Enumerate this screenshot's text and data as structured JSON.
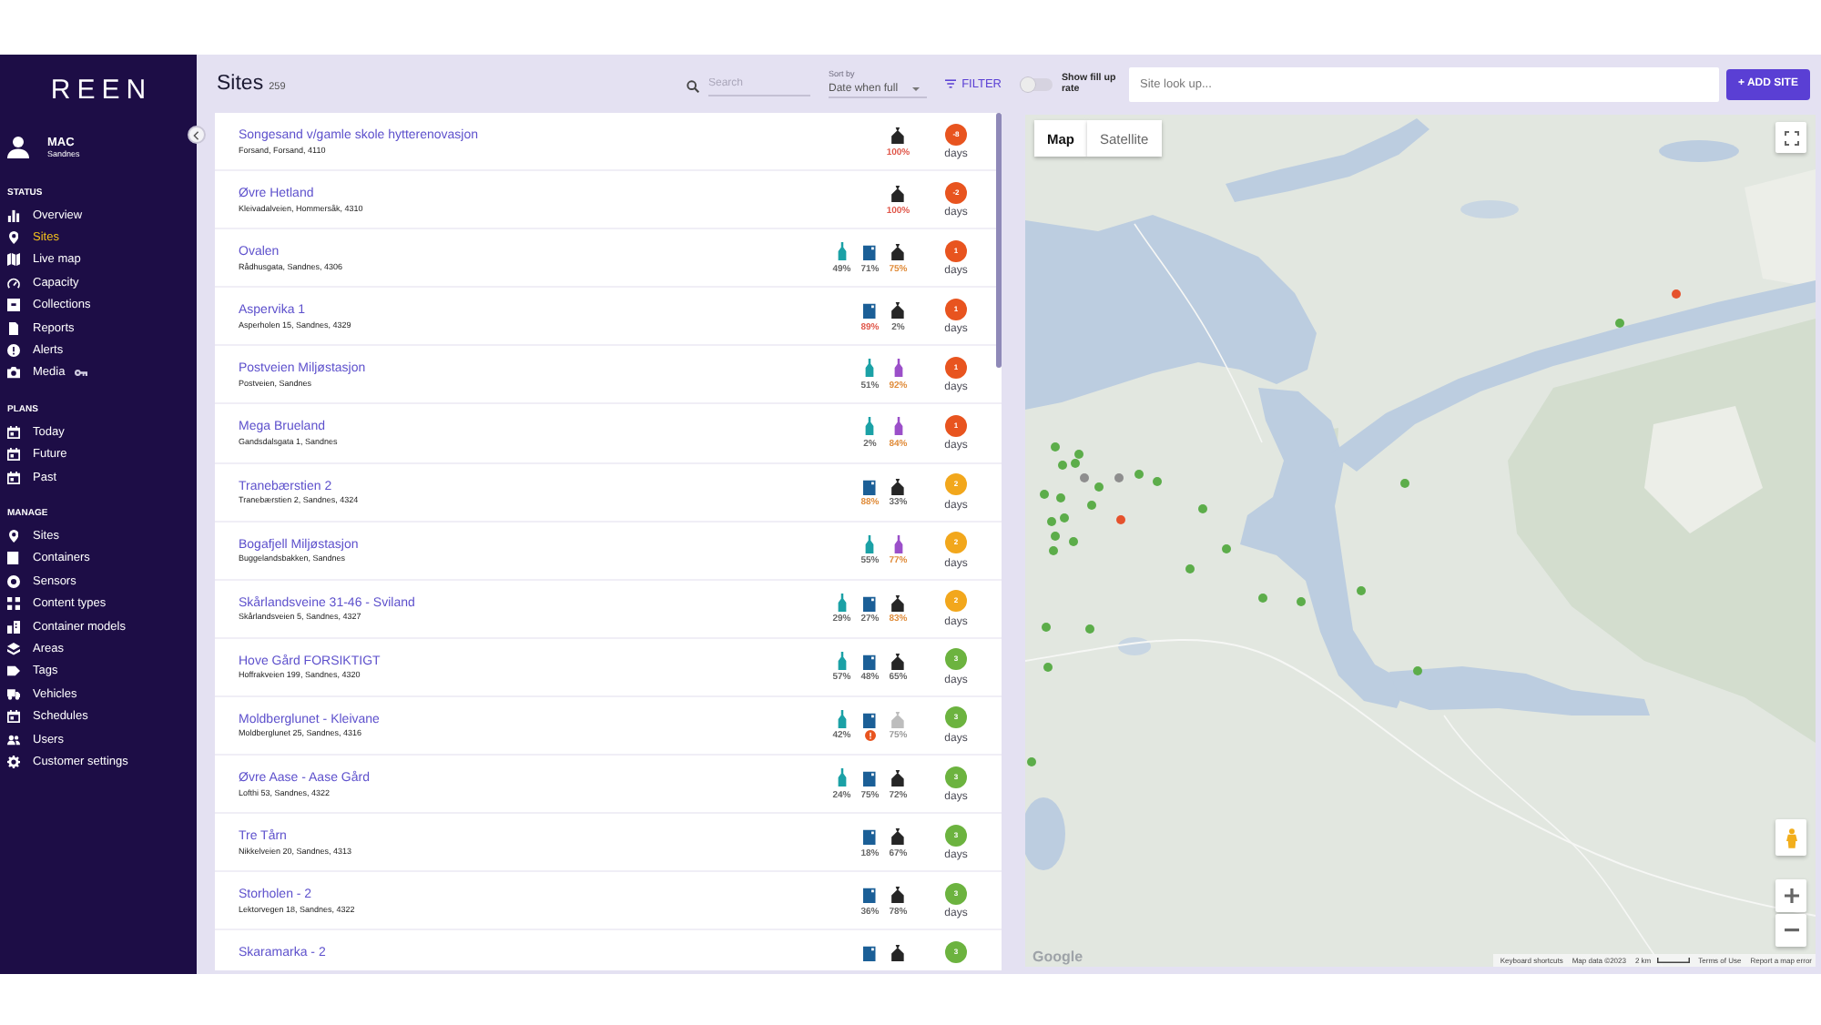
{
  "sidebar": {
    "logo": "REEN",
    "user": {
      "name": "MAC",
      "location": "Sandnes"
    },
    "sections": [
      {
        "title": "STATUS",
        "items": [
          {
            "label": "Overview",
            "selected": false
          },
          {
            "label": "Sites",
            "selected": true
          },
          {
            "label": "Live map",
            "selected": false
          },
          {
            "label": "Capacity",
            "selected": false
          },
          {
            "label": "Collections",
            "selected": false
          },
          {
            "label": "Reports",
            "selected": false
          },
          {
            "label": "Alerts",
            "selected": false
          },
          {
            "label": "Media",
            "selected": false
          }
        ]
      },
      {
        "title": "PLANS",
        "items": [
          {
            "label": "Today",
            "selected": false
          },
          {
            "label": "Future",
            "selected": false
          },
          {
            "label": "Past",
            "selected": false
          }
        ]
      },
      {
        "title": "MANAGE",
        "items": [
          {
            "label": "Sites",
            "selected": false
          },
          {
            "label": "Containers",
            "selected": false
          },
          {
            "label": "Sensors",
            "selected": false
          },
          {
            "label": "Content types",
            "selected": false
          },
          {
            "label": "Container models",
            "selected": false
          },
          {
            "label": "Areas",
            "selected": false
          },
          {
            "label": "Tags",
            "selected": false
          },
          {
            "label": "Vehicles",
            "selected": false
          },
          {
            "label": "Schedules",
            "selected": false
          },
          {
            "label": "Users",
            "selected": false
          },
          {
            "label": "Customer settings",
            "selected": false
          }
        ]
      }
    ]
  },
  "toolbar": {
    "title": "Sites",
    "count": "259",
    "search": {
      "placeholder": "Search"
    },
    "sort": {
      "label": "Sort by",
      "value": "Date when full"
    },
    "filter": "FILTER",
    "fill_up_rate": {
      "label": "Show fill up rate",
      "on": false
    },
    "lookup": {
      "placeholder": "Site look up..."
    },
    "add_button": "+ ADD SITE"
  },
  "sites": [
    {
      "name": "Songesand v/gamle skole hytterenovasjon",
      "address": "Forsand, Forsand, 4110",
      "containers": [
        {
          "kind": "bag",
          "color": "#262626",
          "reading": {
            "text": "100%",
            "color": "#e0574a"
          },
          "alert": false,
          "disabled": false
        }
      ],
      "days": {
        "value": "-8",
        "color": "#e8541f",
        "label": "days"
      }
    },
    {
      "name": "Øvre Hetland",
      "address": "Kleivadalveien, Hommersåk, 4310",
      "containers": [
        {
          "kind": "bag",
          "color": "#262626",
          "reading": {
            "text": "100%",
            "color": "#e0574a"
          },
          "alert": false,
          "disabled": false
        }
      ],
      "days": {
        "value": "-2",
        "color": "#e8541f",
        "label": "days"
      }
    },
    {
      "name": "Ovalen",
      "address": "Rådhusgata, Sandnes, 4306",
      "containers": [
        {
          "kind": "bottle",
          "color": "#1ba1a6",
          "reading": {
            "text": "49%",
            "color": "#666666"
          },
          "alert": false,
          "disabled": false
        },
        {
          "kind": "bin",
          "color": "#1b5f97",
          "reading": {
            "text": "71%",
            "color": "#666666"
          },
          "alert": false,
          "disabled": false
        },
        {
          "kind": "bag",
          "color": "#262626",
          "reading": {
            "text": "75%",
            "color": "#e08c3a"
          },
          "alert": false,
          "disabled": false
        }
      ],
      "days": {
        "value": "1",
        "color": "#e8541f",
        "label": "days"
      }
    },
    {
      "name": "Aspervika 1",
      "address": "Asperholen 15, Sandnes, 4329",
      "containers": [
        {
          "kind": "bin",
          "color": "#1b5f97",
          "reading": {
            "text": "89%",
            "color": "#e0574a"
          },
          "alert": false,
          "disabled": false
        },
        {
          "kind": "bag",
          "color": "#262626",
          "reading": {
            "text": "2%",
            "color": "#666666"
          },
          "alert": false,
          "disabled": false
        }
      ],
      "days": {
        "value": "1",
        "color": "#e8541f",
        "label": "days"
      }
    },
    {
      "name": "Postveien Miljøstasjon",
      "address": "Postveien, Sandnes",
      "containers": [
        {
          "kind": "bottle",
          "color": "#1ba1a6",
          "reading": {
            "text": "51%",
            "color": "#666666"
          },
          "alert": false,
          "disabled": false
        },
        {
          "kind": "bottle",
          "color": "#9b4fc9",
          "reading": {
            "text": "92%",
            "color": "#e08c3a"
          },
          "alert": false,
          "disabled": false
        }
      ],
      "days": {
        "value": "1",
        "color": "#e8541f",
        "label": "days"
      }
    },
    {
      "name": "Mega Brueland",
      "address": "Gandsdalsgata 1, Sandnes",
      "containers": [
        {
          "kind": "bottle",
          "color": "#1ba1a6",
          "reading": {
            "text": "2%",
            "color": "#666666"
          },
          "alert": false,
          "disabled": false
        },
        {
          "kind": "bottle",
          "color": "#9b4fc9",
          "reading": {
            "text": "84%",
            "color": "#e08c3a"
          },
          "alert": false,
          "disabled": false
        }
      ],
      "days": {
        "value": "1",
        "color": "#e8541f",
        "label": "days"
      }
    },
    {
      "name": "Tranebærstien 2",
      "address": "Tranebærstien 2, Sandnes, 4324",
      "containers": [
        {
          "kind": "bin",
          "color": "#1b5f97",
          "reading": {
            "text": "88%",
            "color": "#e08c3a"
          },
          "alert": false,
          "disabled": false
        },
        {
          "kind": "bag",
          "color": "#262626",
          "reading": {
            "text": "33%",
            "color": "#666666"
          },
          "alert": false,
          "disabled": false
        }
      ],
      "days": {
        "value": "2",
        "color": "#f2a71c",
        "label": "days"
      }
    },
    {
      "name": "Bogafjell Miljøstasjon",
      "address": "Buggelandsbakken, Sandnes",
      "containers": [
        {
          "kind": "bottle",
          "color": "#1ba1a6",
          "reading": {
            "text": "55%",
            "color": "#666666"
          },
          "alert": false,
          "disabled": false
        },
        {
          "kind": "bottle",
          "color": "#9b4fc9",
          "reading": {
            "text": "77%",
            "color": "#e08c3a"
          },
          "alert": false,
          "disabled": false
        }
      ],
      "days": {
        "value": "2",
        "color": "#f2a71c",
        "label": "days"
      }
    },
    {
      "name": "Skårlandsveine 31-46 - Sviland",
      "address": "Skårlandsveien 5, Sandnes, 4327",
      "containers": [
        {
          "kind": "bottle",
          "color": "#1ba1a6",
          "reading": {
            "text": "29%",
            "color": "#666666"
          },
          "alert": false,
          "disabled": false
        },
        {
          "kind": "bin",
          "color": "#1b5f97",
          "reading": {
            "text": "27%",
            "color": "#666666"
          },
          "alert": false,
          "disabled": false
        },
        {
          "kind": "bag",
          "color": "#262626",
          "reading": {
            "text": "83%",
            "color": "#e08c3a"
          },
          "alert": false,
          "disabled": false
        }
      ],
      "days": {
        "value": "2",
        "color": "#f2a71c",
        "label": "days"
      }
    },
    {
      "name": "Hove Gård FORSIKTIGT",
      "address": "Hoffrakveien 199, Sandnes, 4320",
      "containers": [
        {
          "kind": "bottle",
          "color": "#1ba1a6",
          "reading": {
            "text": "57%",
            "color": "#666666"
          },
          "alert": false,
          "disabled": false
        },
        {
          "kind": "bin",
          "color": "#1b5f97",
          "reading": {
            "text": "48%",
            "color": "#666666"
          },
          "alert": false,
          "disabled": false
        },
        {
          "kind": "bag",
          "color": "#262626",
          "reading": {
            "text": "65%",
            "color": "#666666"
          },
          "alert": false,
          "disabled": false
        }
      ],
      "days": {
        "value": "3",
        "color": "#6cb33f",
        "label": "days"
      }
    },
    {
      "name": "Moldberglunet - Kleivane",
      "address": "Moldberglunet 25, Sandnes, 4316",
      "containers": [
        {
          "kind": "bottle",
          "color": "#1ba1a6",
          "reading": {
            "text": "42%",
            "color": "#666666"
          },
          "alert": false,
          "disabled": false
        },
        {
          "kind": "bin",
          "color": "#1b5f97",
          "alert": true,
          "disabled": false
        },
        {
          "kind": "bag",
          "reading": {
            "text": "75%"
          },
          "alert": false,
          "disabled": true
        }
      ],
      "days": {
        "value": "3",
        "color": "#6cb33f",
        "label": "days"
      }
    },
    {
      "name": "Øvre Aase - Aase Gård",
      "address": "Lofthi 53, Sandnes, 4322",
      "containers": [
        {
          "kind": "bottle",
          "color": "#1ba1a6",
          "reading": {
            "text": "24%",
            "color": "#666666"
          },
          "alert": false,
          "disabled": false
        },
        {
          "kind": "bin",
          "color": "#1b5f97",
          "reading": {
            "text": "75%",
            "color": "#666666"
          },
          "alert": false,
          "disabled": false
        },
        {
          "kind": "bag",
          "color": "#262626",
          "reading": {
            "text": "72%",
            "color": "#666666"
          },
          "alert": false,
          "disabled": false
        }
      ],
      "days": {
        "value": "3",
        "color": "#6cb33f",
        "label": "days"
      }
    },
    {
      "name": "Tre Tårn",
      "address": "Nikkelveien 20, Sandnes, 4313",
      "containers": [
        {
          "kind": "bin",
          "color": "#1b5f97",
          "reading": {
            "text": "18%",
            "color": "#666666"
          },
          "alert": false,
          "disabled": false
        },
        {
          "kind": "bag",
          "color": "#262626",
          "reading": {
            "text": "67%",
            "color": "#666666"
          },
          "alert": false,
          "disabled": false
        }
      ],
      "days": {
        "value": "3",
        "color": "#6cb33f",
        "label": "days"
      }
    },
    {
      "name": "Storholen - 2",
      "address": "Lektorvegen 18, Sandnes, 4322",
      "containers": [
        {
          "kind": "bin",
          "color": "#1b5f97",
          "reading": {
            "text": "36%",
            "color": "#666666"
          },
          "alert": false,
          "disabled": false
        },
        {
          "kind": "bag",
          "color": "#262626",
          "reading": {
            "text": "78%",
            "color": "#666666"
          },
          "alert": false,
          "disabled": false
        }
      ],
      "days": {
        "value": "3",
        "color": "#6cb33f",
        "label": "days"
      }
    },
    {
      "name": "Skaramarka - 2",
      "containers": [
        {
          "kind": "bin",
          "color": "#1b5f97",
          "disabled": false
        },
        {
          "kind": "bag",
          "color": "#262626",
          "disabled": false
        }
      ],
      "days": {
        "value": "3",
        "color": "#6cb33f"
      }
    }
  ],
  "map": {
    "tabs": [
      {
        "label": "Map",
        "selected": true
      },
      {
        "label": "Satellite",
        "selected": false
      }
    ],
    "markers": [
      {
        "color": "#5cad4a"
      },
      {
        "color": "#5cad4a"
      },
      {
        "color": "#5cad4a"
      },
      {
        "color": "#5cad4a"
      },
      {
        "color": "#5cad4a"
      },
      {
        "color": "#5cad4a"
      },
      {
        "color": "#5cad4a"
      },
      {
        "color": "#5cad4a"
      },
      {
        "color": "#5cad4a"
      },
      {
        "color": "#5cad4a"
      },
      {
        "color": "#5cad4a"
      },
      {
        "color": "#5cad4a"
      },
      {
        "color": "#5cad4a"
      },
      {
        "color": "#5cad4a"
      },
      {
        "color": "#5cad4a"
      },
      {
        "color": "#5cad4a"
      },
      {
        "color": "#5cad4a"
      },
      {
        "color": "#5cad4a"
      },
      {
        "color": "#5cad4a"
      },
      {
        "color": "#5cad4a"
      },
      {
        "color": "#5cad4a"
      },
      {
        "color": "#5cad4a"
      },
      {
        "color": "#5cad4a"
      },
      {
        "color": "#5cad4a"
      },
      {
        "color": "#5cad4a"
      },
      {
        "color": "#5cad4a"
      },
      {
        "color": "#5cad4a"
      },
      {
        "color": "#5cad4a"
      },
      {
        "color": "#8e8e8e"
      },
      {
        "color": "#8e8e8e"
      },
      {
        "color": "#e5522d"
      },
      {
        "color": "#e5522d"
      }
    ],
    "logo": "Google",
    "attribution": {
      "shortcuts": "Keyboard shortcuts",
      "data": "Map data ©2023",
      "scale": "2 km",
      "terms": "Terms of Use",
      "report": "Report a map error"
    }
  }
}
